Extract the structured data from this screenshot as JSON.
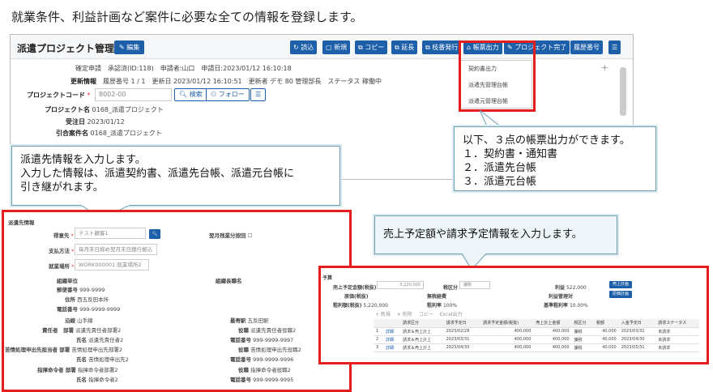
{
  "caption": "就業条件、利益計画など案件に必要な全ての情報を登録します。",
  "main": {
    "title": "派遣プロジェクト管理",
    "edit": "編集",
    "toolbar": [
      "読込",
      "新規",
      "コピー",
      "延長",
      "枝番発行",
      "帳票出力",
      "プロジェクト完了",
      "履歴番号"
    ],
    "status_line": "確定申請　承認済(ID:118)　申請者:山口　申請日:2023/01/12 16:10:18",
    "update_label": "更新情報",
    "update_text": "履歴番号 1 / 1　更新日 2023/01/12 16:10:51　更新者 デモ 80 管理部長　ステータス 稼働中",
    "code_label": "プロジェクトコード",
    "code_value": "8002-00",
    "search_btn": "検索",
    "follow_btn": "フォロー",
    "name_label": "プロジェクト名",
    "name_value": "0168_派遣プロジェクト",
    "order_label": "受注日",
    "order_value": "2023/01/12",
    "inherit_label": "引合案件名",
    "inherit_value": "0168_派遣プロジェクト",
    "dropdown": [
      "契約書出力",
      "派遣先管理台帳",
      "派遣元管理台帳"
    ],
    "plus": "+"
  },
  "callout_right": [
    "以下、３点の帳票出力ができます。",
    "１．契約書・通知書",
    "２．派遣先台帳",
    "３．派遣元台帳"
  ],
  "callout_left": [
    "派遣先情報を入力します。",
    "入力した情報は、派遣契約書、派遣先台帳、派遣元台帳に",
    "引き継がれます。"
  ],
  "callout_sales": "売上予定額や請求予定情報を入力します。",
  "p2": {
    "section": "派遣先情報",
    "client_label": "得意先",
    "client_value": "テスト顧客1",
    "overtime_label": "翌月残業分按回",
    "pay_label": "支払方法",
    "pay_value": "毎月末日締め翌月末日銀行振込",
    "place_label": "就業場所",
    "place_value": "WORK000001:就業場所2",
    "org_label": "組織単位",
    "org_right": "組織長職名",
    "zip_label": "郵便番号",
    "zip_value": "999-9999",
    "addr_label": "住所",
    "addr_value": "西五反田本所",
    "tel_label": "電話番号",
    "tel_value": "999-9999-9999",
    "line_label": "沿線",
    "line_value": "山手線",
    "station_label": "最寄駅",
    "station_value": "五反田駅",
    "resp_dept_label": "責任者　部署",
    "resp_dept_value": "派遣先責任者部署2",
    "resp_title_label": "役職",
    "resp_title_value": "派遣先責任者役職2",
    "resp_name_label": "氏名",
    "resp_name_value": "派遣先責任者2",
    "resp_tel_label": "電話番号",
    "resp_tel_value": "999-9999-9997",
    "comp_dept_label": "苦情処理申出先担当者 部署",
    "comp_dept_value": "苦情処理申出先部署2",
    "comp_title_label": "役職",
    "comp_title_value": "苦情処理申出先役職2",
    "comp_name_label": "氏名",
    "comp_name_value": "苦情処理申出先2",
    "comp_tel_label": "電話番号",
    "comp_tel_value": "999-9999-9996",
    "cmd_dept_label": "指揮命令者 部署",
    "cmd_dept_value": "指揮命令者部署2",
    "cmd_title_label": "役職",
    "cmd_title_value": "指揮命令者役職2",
    "cmd_name_label": "氏名",
    "cmd_name_value": "指揮命令者2",
    "cmd_tel_label": "電話番号",
    "cmd_tel_value": "999-9999-9995"
  },
  "p3": {
    "section": "予算",
    "sales_label": "売上予定金額(税抜)",
    "sales_value": "5,220,000",
    "tax_label": "税区分",
    "tax_value": "課税",
    "profit_label": "利益",
    "profit_value": "522,000",
    "profit_btn": "売上計画",
    "cost_label": "原価(税抜)",
    "nocost_label": "無税経費",
    "ctrl_label": "利益管理対",
    "ctrl_btn": "原価計画",
    "rate_label": "粗利額(税抜)",
    "rate_value": "5,220,000",
    "profitrate_label": "粗利率",
    "profitrate_value": "100%",
    "base_label": "基準粗利率",
    "base_value": "10.00%",
    "tb": [
      "+ 新規",
      "✕ 削除",
      "コピー",
      "Excel出力"
    ],
    "headers": [
      "",
      "",
      "請求区分",
      "請求予定日",
      "請求予定金額(税抜)",
      "売上計上金額",
      "税区分",
      "税額",
      "入金予定日",
      "請求ステータス"
    ],
    "rows": [
      [
        "1",
        "詳細",
        "請求＆売上計上",
        "2023/02/28",
        "400,000",
        "400,000",
        "課税",
        "40,000",
        "2023/03/31",
        "未請求"
      ],
      [
        "2",
        "詳細",
        "請求＆売上計上",
        "2023/03/31",
        "400,000",
        "400,000",
        "課税",
        "40,000",
        "2023/04/30",
        "未請求"
      ],
      [
        "3",
        "詳細",
        "請求＆売上計上",
        "2023/04/30",
        "400,000",
        "400,000",
        "課税",
        "40,000",
        "2023/05/31",
        "未請求"
      ]
    ]
  }
}
